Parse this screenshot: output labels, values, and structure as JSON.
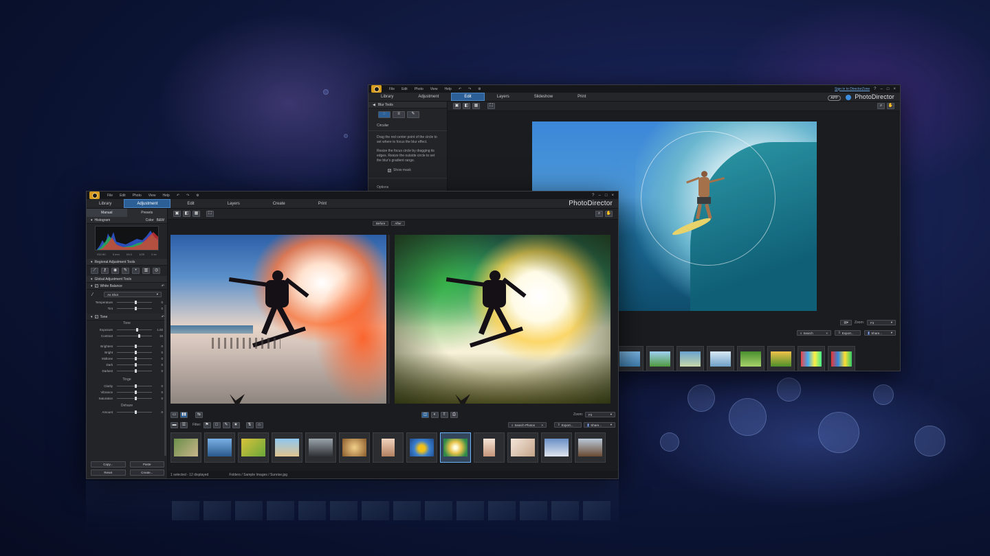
{
  "colors": {
    "accent": "#2b5f95",
    "logo": "#d59a1e",
    "selection": "#6cb6ff"
  },
  "back_window": {
    "menu": [
      "File",
      "Edit",
      "Photo",
      "View",
      "Help"
    ],
    "signin": "Sign in to DirectorZone",
    "tabs": [
      "Library",
      "Adjustment",
      "Edit",
      "Layers",
      "Slideshow",
      "Print"
    ],
    "active_tab": "Edit",
    "app_badge": "APP",
    "brand": "PhotoDirector",
    "side": {
      "title": "Blur Tools",
      "mode": "Circular",
      "para1": "Drag the red center point of the circle to set where to focus the blur effect.",
      "para2": "Resize the focus circle by dragging its edges. Resize the outside circle to set the blur's gradient range.",
      "show_mask": "Show mask",
      "options": "Options"
    },
    "zoom_label": "Zoom:",
    "zoom_value": "Fit",
    "search": "Search",
    "export": "Export...",
    "share": "Share..."
  },
  "front_window": {
    "menu": [
      "File",
      "Edit",
      "Photo",
      "View",
      "Help"
    ],
    "tabs": [
      "Library",
      "Adjustment",
      "Edit",
      "Layers",
      "Create",
      "Print"
    ],
    "active_tab": "Adjustment",
    "brand": "PhotoDirector",
    "subtabs": [
      "Manual",
      "Presets"
    ],
    "histogram": {
      "title": "Histogram",
      "color": "Color",
      "bw": "B&W",
      "stats": [
        "ISO 80",
        "5 mm",
        "f/4.0",
        "1/25",
        "0 ev"
      ]
    },
    "regional_title": "Regional Adjustment Tools",
    "global_title": "Global Adjustment Tools",
    "white_balance": {
      "title": "White Balance",
      "preset": "As Shot",
      "sliders": [
        {
          "name": "Temperature",
          "value": "0",
          "pos": 0.5
        },
        {
          "name": "Tint",
          "value": "0",
          "pos": 0.5
        }
      ]
    },
    "tone": {
      "title": "Tone",
      "group1": "Tone",
      "sliders1": [
        {
          "name": "Exposure",
          "value": "1.02",
          "pos": 0.55
        },
        {
          "name": "Contrast",
          "value": "15",
          "pos": 0.6
        }
      ],
      "sliders2": [
        {
          "name": "Brightest",
          "value": "0",
          "pos": 0.5
        },
        {
          "name": "Bright",
          "value": "0",
          "pos": 0.5
        },
        {
          "name": "Midtone",
          "value": "0",
          "pos": 0.5
        },
        {
          "name": "Dark",
          "value": "0",
          "pos": 0.5
        },
        {
          "name": "Darkest",
          "value": "0",
          "pos": 0.5
        }
      ],
      "group2": "Tinge",
      "sliders3": [
        {
          "name": "Clarity",
          "value": "0",
          "pos": 0.5
        },
        {
          "name": "Vibrance",
          "value": "0",
          "pos": 0.5
        },
        {
          "name": "Saturation",
          "value": "0",
          "pos": 0.5
        }
      ],
      "group3": "Dehaze",
      "sliders4": [
        {
          "name": "Amount",
          "value": "0",
          "pos": 0.5
        }
      ]
    },
    "buttons": {
      "copy": "Copy...",
      "paste": "Paste",
      "reset": "Reset",
      "create": "Create..."
    },
    "before": "Before",
    "after": "After",
    "filter": "Filter:",
    "zoom_label": "Zoom:",
    "zoom_value": "Fit",
    "search": "Search Photos",
    "export": "Export...",
    "share": "Share...",
    "status": "1 selected - 12 displayed",
    "path": "Folders / Sample Images / Sunrise.jpg"
  }
}
